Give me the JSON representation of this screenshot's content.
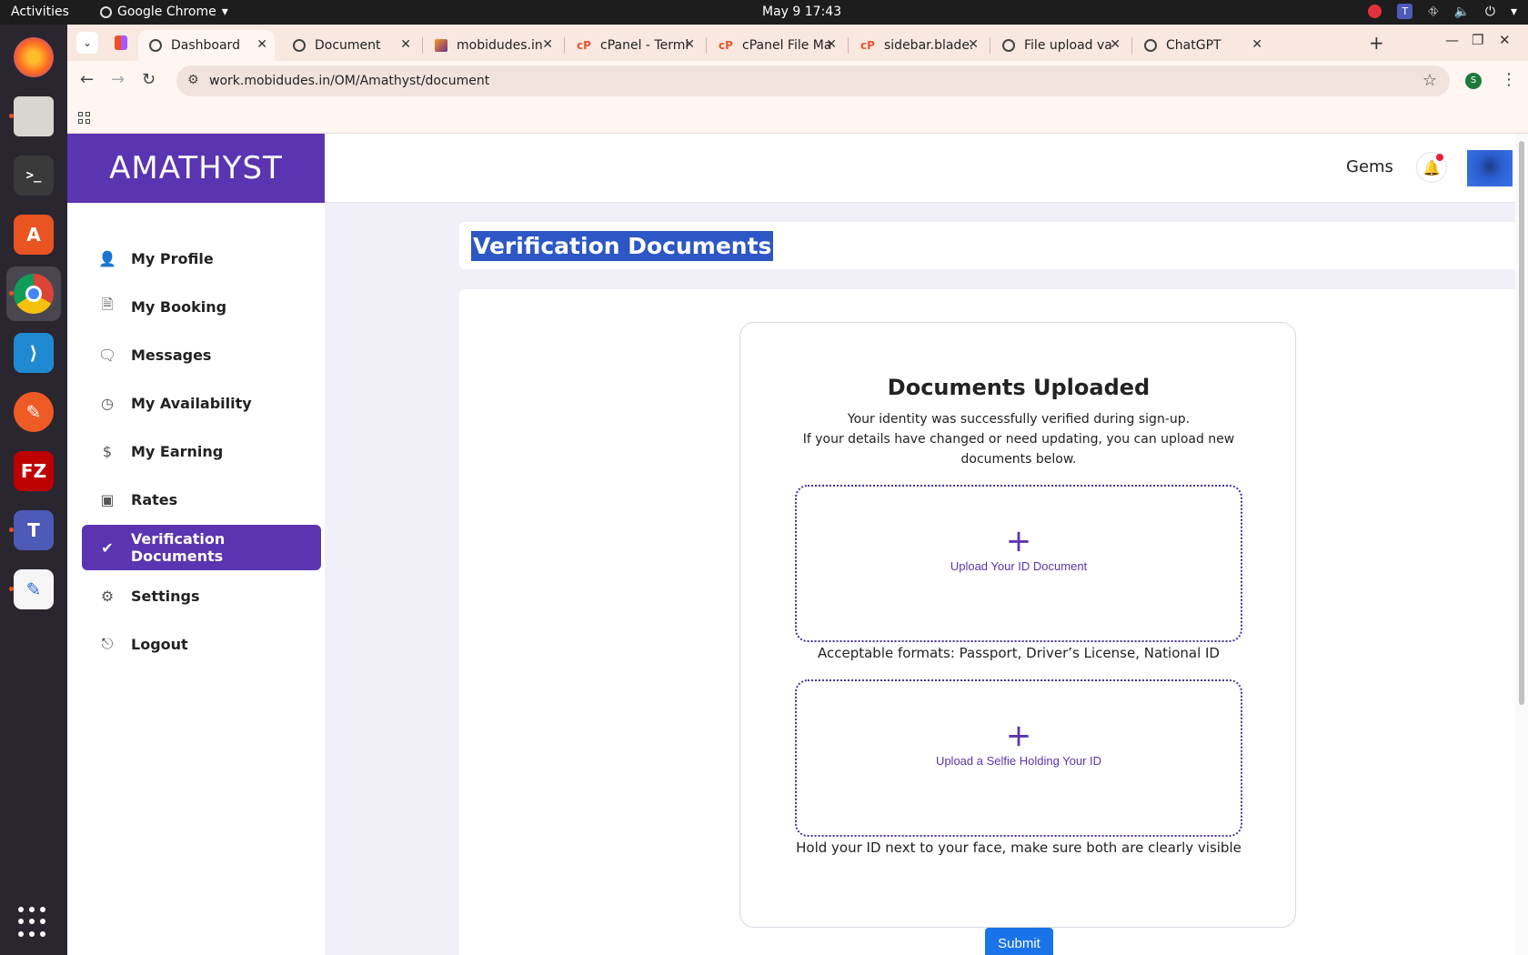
{
  "system": {
    "activities": "Activities",
    "app_name": "Google Chrome",
    "clock": "May 9  17:43"
  },
  "browser": {
    "tabs": [
      {
        "title": "Dashboard",
        "active": true
      },
      {
        "title": "Document"
      },
      {
        "title": "mobidudes.in"
      },
      {
        "title": "cPanel - Termi"
      },
      {
        "title": "cPanel File Ma"
      },
      {
        "title": "sidebar.blade."
      },
      {
        "title": "File upload va"
      },
      {
        "title": "ChatGPT"
      }
    ],
    "url": "work.mobidudes.in/OM/Amathyst/document",
    "profile_initial": "S"
  },
  "app": {
    "brand": "AMATHYST",
    "header": {
      "gems_label": "Gems"
    },
    "sidebar": [
      {
        "label": "My Profile",
        "icon": "user-icon"
      },
      {
        "label": "My Booking",
        "icon": "document-icon"
      },
      {
        "label": "Messages",
        "icon": "chat-icon"
      },
      {
        "label": "My Availability",
        "icon": "clock-icon"
      },
      {
        "label": "My Earning",
        "icon": "dollar-icon"
      },
      {
        "label": "Rates",
        "icon": "money-icon"
      },
      {
        "label": "Verification Documents",
        "icon": "check-circle-icon",
        "active": true
      },
      {
        "label": "Settings",
        "icon": "gear-icon"
      },
      {
        "label": "Logout",
        "icon": "logout-icon"
      }
    ],
    "page_title": "Verification Documents",
    "card": {
      "title": "Documents Uploaded",
      "desc_line1": "Your identity was successfully verified during sign-up.",
      "desc_line2": "If your details have changed or need updating, you can upload new documents below.",
      "upload_id_label": "Upload Your ID Document",
      "id_hint": "Acceptable formats: Passport, Driver’s License, National ID",
      "upload_selfie_label": "Upload a Selfie Holding Your ID",
      "selfie_hint": "Hold your ID next to your face, make sure both are clearly visible"
    },
    "submit_label": "Submit"
  },
  "colors": {
    "brand_purple": "#5b34b1",
    "submit_blue": "#1a73e8",
    "selection_blue": "#2c57c4"
  }
}
